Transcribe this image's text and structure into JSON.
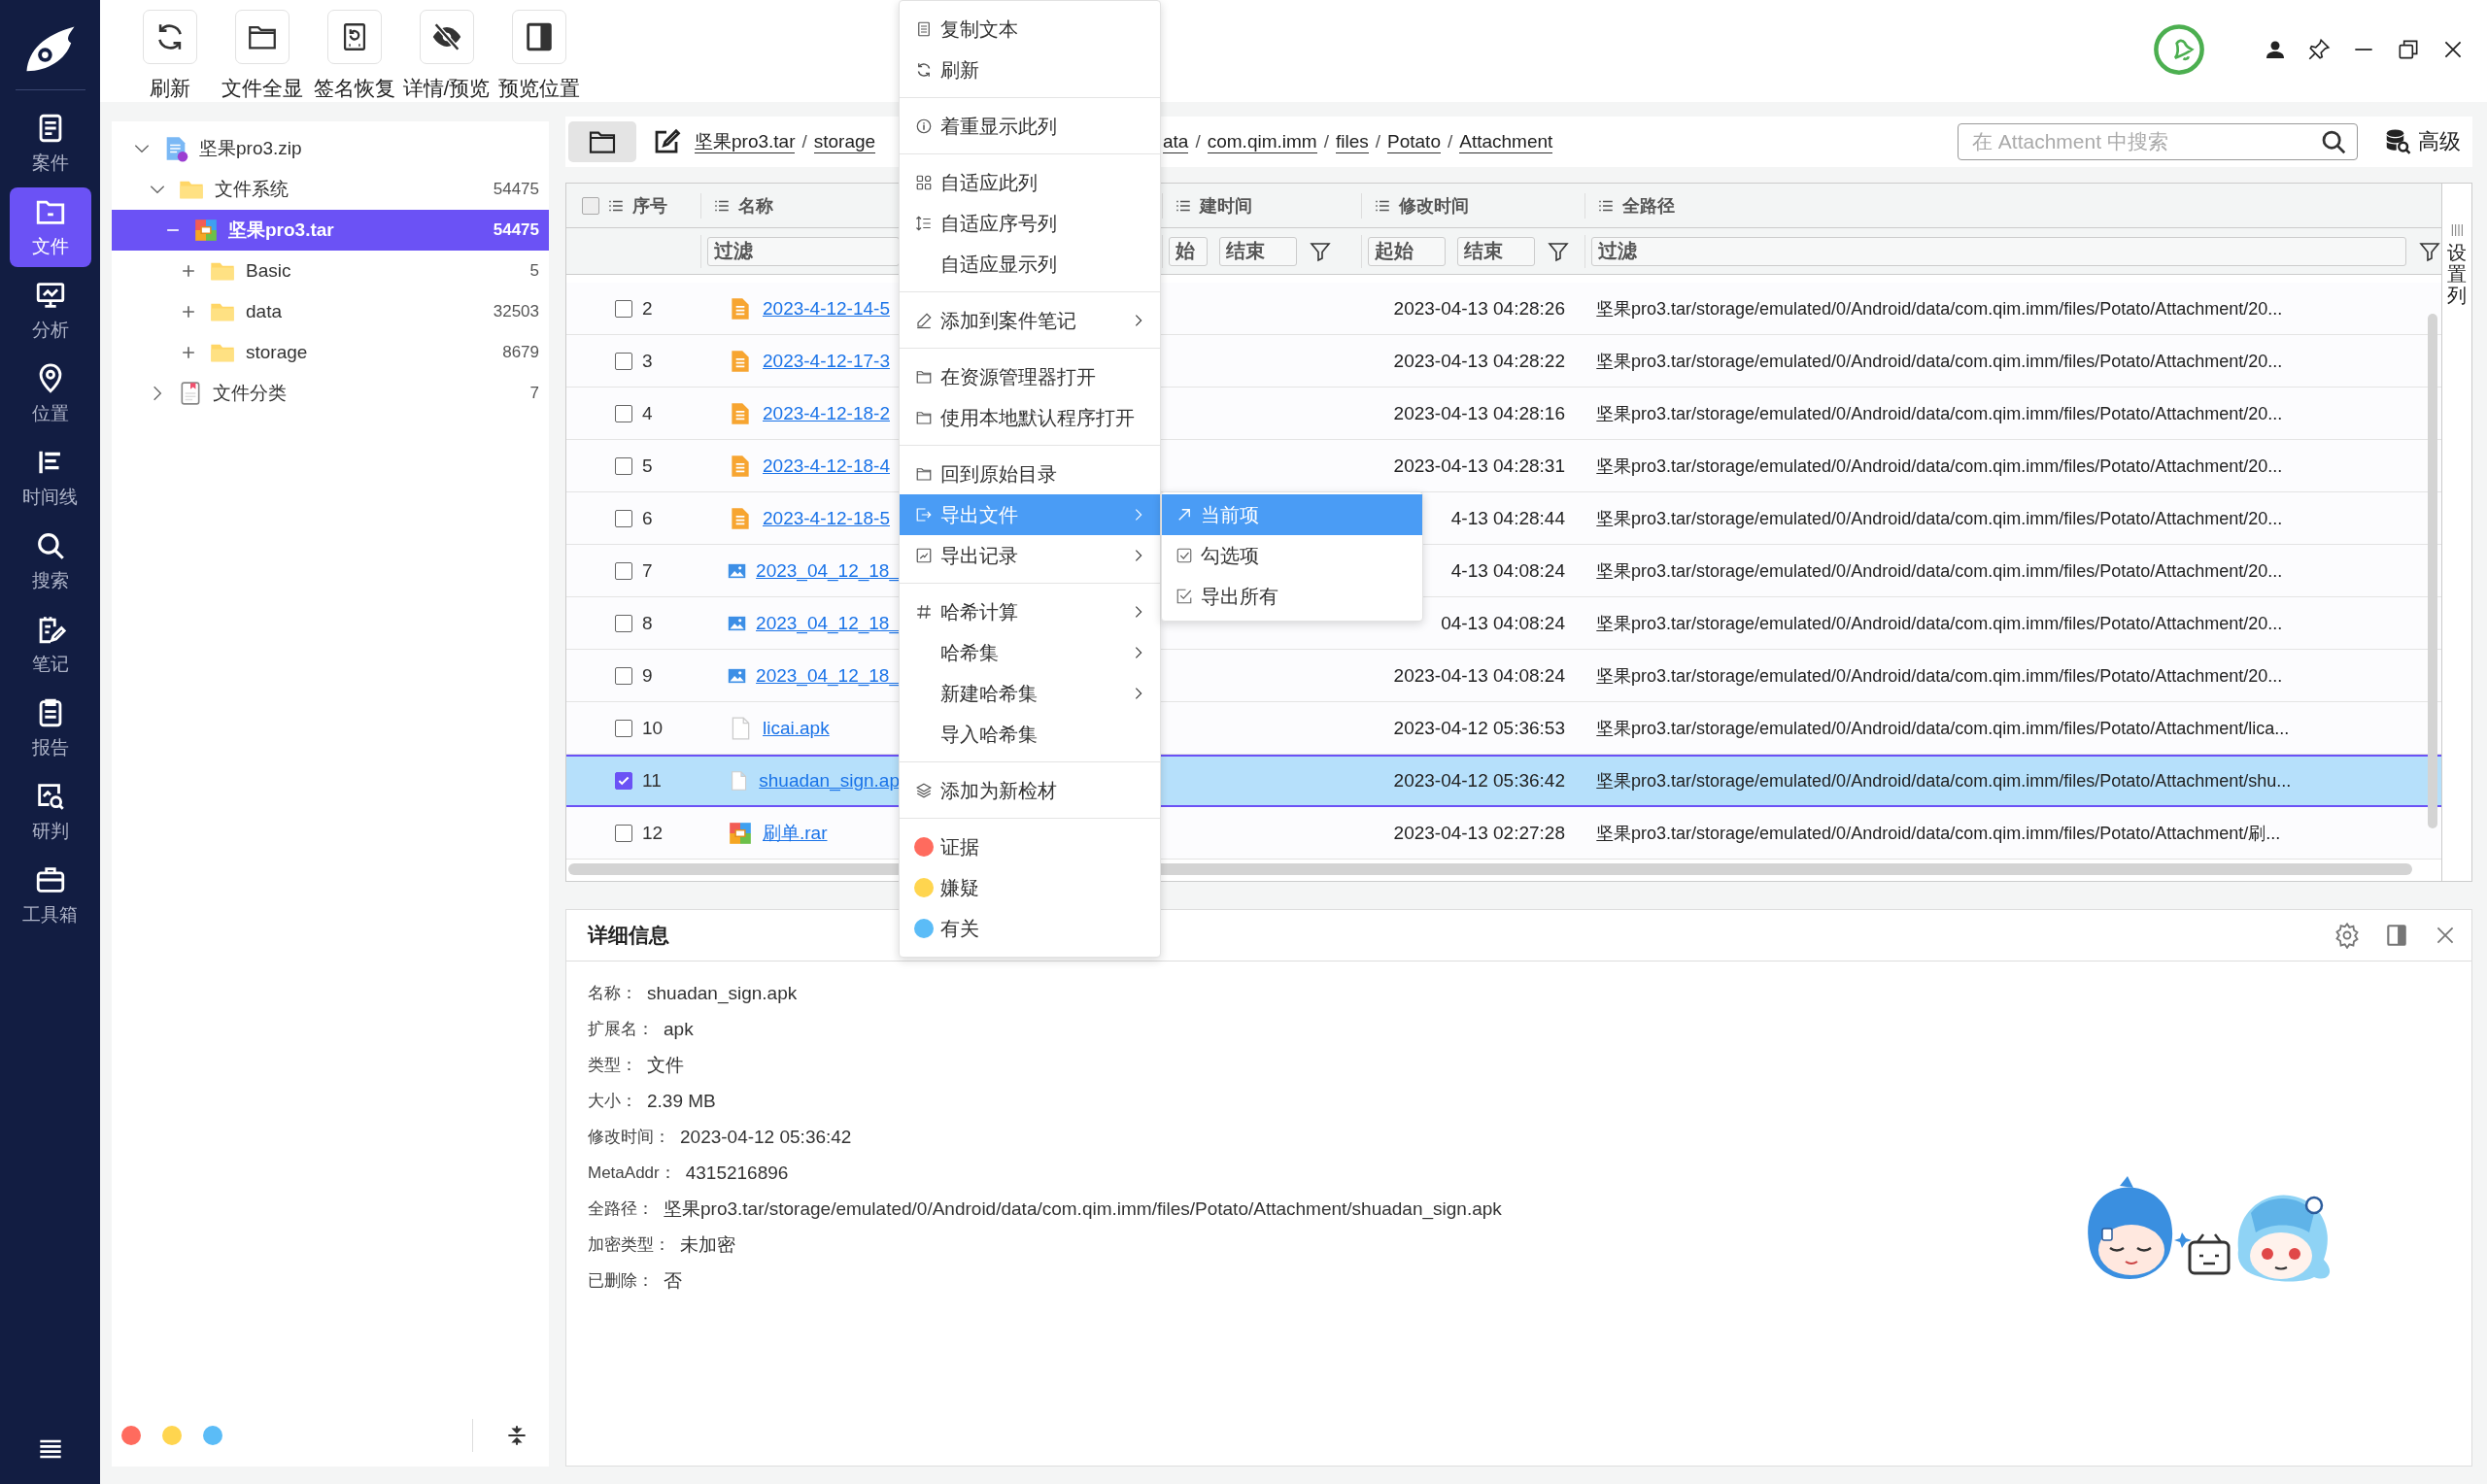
{
  "toolbar": [
    {
      "label": "刷新"
    },
    {
      "label": "文件全显"
    },
    {
      "label": "签名恢复"
    },
    {
      "label": "详情/预览"
    },
    {
      "label": "预览位置"
    }
  ],
  "sidebar": {
    "items": [
      {
        "label": "案件",
        "selected": false
      },
      {
        "label": "文件",
        "selected": true
      },
      {
        "label": "分析",
        "selected": false
      },
      {
        "label": "位置",
        "selected": false
      },
      {
        "label": "时间线",
        "selected": false
      },
      {
        "label": "搜索",
        "selected": false
      },
      {
        "label": "笔记",
        "selected": false
      },
      {
        "label": "报告",
        "selected": false
      },
      {
        "label": "研判",
        "selected": false
      },
      {
        "label": "工具箱",
        "selected": false
      }
    ]
  },
  "tree": [
    {
      "label": "坚果pro3.zip",
      "kind": "zip",
      "expanded": true,
      "selected": false,
      "children": [
        {
          "label": "文件系统",
          "count": "54475",
          "kind": "folder",
          "expanded": true,
          "selected": false,
          "children": [
            {
              "label": "坚果pro3.tar",
              "count": "54475",
              "kind": "archive",
              "expanded": true,
              "selected": true,
              "children": [
                {
                  "label": "Basic",
                  "count": "5",
                  "kind": "folder",
                  "expanded": false,
                  "selected": false
                },
                {
                  "label": "data",
                  "count": "32503",
                  "kind": "folder",
                  "expanded": false,
                  "selected": false
                },
                {
                  "label": "storage",
                  "count": "8679",
                  "kind": "folder",
                  "expanded": false,
                  "selected": false
                }
              ]
            }
          ]
        },
        {
          "label": "文件分类",
          "count": "7",
          "kind": "category",
          "expanded": false,
          "selected": false
        }
      ]
    }
  ],
  "tag_filters": [
    {
      "color": "#ff6b5e"
    },
    {
      "color": "#ffd54f"
    },
    {
      "color": "#5bbcf7"
    }
  ],
  "breadcrumb": {
    "start": [
      {
        "kind": "segment",
        "label": "坚果pro3.tar"
      },
      {
        "kind": "separator",
        "label": "/"
      },
      {
        "kind": "segment",
        "label": "storage"
      }
    ],
    "end": [
      {
        "kind": "segment",
        "label": "ata"
      },
      {
        "kind": "separator",
        "label": "/"
      },
      {
        "kind": "segment",
        "label": "com.qim.imm"
      },
      {
        "kind": "separator",
        "label": "/"
      },
      {
        "kind": "segment",
        "label": "files"
      },
      {
        "kind": "separator",
        "label": "/"
      },
      {
        "kind": "segment",
        "label": "Potato"
      },
      {
        "kind": "separator",
        "label": "/"
      },
      {
        "kind": "segment",
        "label": "Attachment"
      }
    ]
  },
  "search": {
    "placeholder": "在 Attachment 中搜索"
  },
  "advanced_button": {
    "label": "高级"
  },
  "table": {
    "all_checked": false,
    "columns": [
      {
        "label": "序号"
      },
      {
        "label": "名称",
        "filters": [
          {
            "placeholder": "过滤"
          }
        ]
      },
      {
        "label": "建时间",
        "filters": [
          {
            "placeholder": "始"
          },
          {
            "placeholder": "结束"
          }
        ]
      },
      {
        "label": "修改时间",
        "filters": [
          {
            "placeholder": "起始"
          },
          {
            "placeholder": "结束"
          }
        ]
      },
      {
        "label": "全路径",
        "filters": [
          {
            "placeholder": "过滤"
          }
        ]
      }
    ],
    "rows": [
      {
        "checked": false,
        "selected": false,
        "number": "2",
        "kind": "document",
        "name": "2023-4-12-14-5",
        "modified": "2023-04-13 04:28:26",
        "path": "坚果pro3.tar/storage/emulated/0/Android/data/com.qim.imm/files/Potato/Attachment/20..."
      },
      {
        "checked": false,
        "selected": false,
        "number": "3",
        "kind": "document",
        "name": "2023-4-12-17-3",
        "modified": "2023-04-13 04:28:22",
        "path": "坚果pro3.tar/storage/emulated/0/Android/data/com.qim.imm/files/Potato/Attachment/20..."
      },
      {
        "checked": false,
        "selected": false,
        "number": "4",
        "kind": "document",
        "name": "2023-4-12-18-2",
        "modified": "2023-04-13 04:28:16",
        "path": "坚果pro3.tar/storage/emulated/0/Android/data/com.qim.imm/files/Potato/Attachment/20..."
      },
      {
        "checked": false,
        "selected": false,
        "number": "5",
        "kind": "document",
        "name": "2023-4-12-18-4",
        "modified": "2023-04-13 04:28:31",
        "path": "坚果pro3.tar/storage/emulated/0/Android/data/com.qim.imm/files/Potato/Attachment/20..."
      },
      {
        "checked": false,
        "selected": false,
        "number": "6",
        "kind": "document",
        "name": "2023-4-12-18-5",
        "modified": "4-13 04:28:44",
        "path": "坚果pro3.tar/storage/emulated/0/Android/data/com.qim.imm/files/Potato/Attachment/20..."
      },
      {
        "checked": false,
        "selected": false,
        "number": "7",
        "kind": "image",
        "name": "2023_04_12_18_",
        "modified": "4-13 04:08:24",
        "path": "坚果pro3.tar/storage/emulated/0/Android/data/com.qim.imm/files/Potato/Attachment/20..."
      },
      {
        "checked": false,
        "selected": false,
        "number": "8",
        "kind": "image",
        "name": "2023_04_12_18_",
        "modified": "04-13 04:08:24",
        "path": "坚果pro3.tar/storage/emulated/0/Android/data/com.qim.imm/files/Potato/Attachment/20..."
      },
      {
        "checked": false,
        "selected": false,
        "number": "9",
        "kind": "image",
        "name": "2023_04_12_18_",
        "modified": "2023-04-13 04:08:24",
        "path": "坚果pro3.tar/storage/emulated/0/Android/data/com.qim.imm/files/Potato/Attachment/20..."
      },
      {
        "checked": false,
        "selected": false,
        "number": "10",
        "kind": "file",
        "name": "licai.apk",
        "modified": "2023-04-12 05:36:53",
        "path": "坚果pro3.tar/storage/emulated/0/Android/data/com.qim.imm/files/Potato/Attachment/lica..."
      },
      {
        "checked": true,
        "selected": true,
        "number": "11",
        "kind": "file",
        "name": "shuadan_sign.ap",
        "modified": "2023-04-12 05:36:42",
        "path": "坚果pro3.tar/storage/emulated/0/Android/data/com.qim.imm/files/Potato/Attachment/shu..."
      },
      {
        "checked": false,
        "selected": false,
        "number": "12",
        "kind": "archive",
        "name": "刷单.rar",
        "modified": "2023-04-13 02:27:28",
        "path": "坚果pro3.tar/storage/emulated/0/Android/data/com.qim.imm/files/Potato/Attachment/刷..."
      }
    ]
  },
  "column_settings": {
    "label": "设置列"
  },
  "context_menu": {
    "groups": [
      {
        "items": [
          {
            "label": "复制文本",
            "submenu": false,
            "selected": false
          },
          {
            "label": "刷新",
            "submenu": false,
            "selected": false
          }
        ]
      },
      {
        "items": [
          {
            "label": "着重显示此列",
            "submenu": false,
            "selected": false
          }
        ]
      },
      {
        "items": [
          {
            "label": "自适应此列",
            "submenu": false,
            "selected": false
          },
          {
            "label": "自适应序号列",
            "submenu": false,
            "selected": false
          },
          {
            "label": "自适应显示列",
            "submenu": false,
            "selected": false
          }
        ]
      },
      {
        "items": [
          {
            "label": "添加到案件笔记",
            "submenu": true,
            "selected": false
          }
        ]
      },
      {
        "items": [
          {
            "label": "在资源管理器打开",
            "submenu": false,
            "selected": false
          },
          {
            "label": "使用本地默认程序打开",
            "submenu": false,
            "selected": false
          }
        ]
      },
      {
        "items": [
          {
            "label": "回到原始目录",
            "submenu": false,
            "selected": false
          },
          {
            "label": "导出文件",
            "submenu": true,
            "selected": true
          },
          {
            "label": "导出记录",
            "submenu": true,
            "selected": false
          }
        ]
      },
      {
        "items": [
          {
            "label": "哈希计算",
            "submenu": true,
            "selected": false
          },
          {
            "label": "哈希集",
            "submenu": true,
            "selected": false
          },
          {
            "label": "新建哈希集",
            "submenu": true,
            "selected": false
          },
          {
            "label": "导入哈希集",
            "submenu": false,
            "selected": false
          }
        ]
      },
      {
        "items": [
          {
            "label": "添加为新检材",
            "submenu": false,
            "selected": false
          }
        ]
      },
      {
        "items": [
          {
            "label": "证据",
            "color": "#ff6b5e",
            "submenu": false,
            "selected": false
          },
          {
            "label": "嫌疑",
            "color": "#ffd54f",
            "submenu": false,
            "selected": false
          },
          {
            "label": "有关",
            "color": "#5bbcf7",
            "submenu": false,
            "selected": false
          }
        ]
      }
    ]
  },
  "submenu": {
    "items": [
      {
        "label": "当前项",
        "selected": true
      },
      {
        "label": "勾选项",
        "selected": false
      },
      {
        "label": "导出所有",
        "selected": false
      }
    ]
  },
  "details": {
    "title": "详细信息",
    "fields": [
      {
        "label": "名称：",
        "value": "shuadan_sign.apk"
      },
      {
        "label": "扩展名：",
        "value": "apk"
      },
      {
        "label": "类型：",
        "value": "文件"
      },
      {
        "label": "大小：",
        "value": "2.39 MB"
      },
      {
        "label": "修改时间：",
        "value": "2023-04-12 05:36:42"
      },
      {
        "label": "MetaAddr：",
        "value": "4315216896"
      },
      {
        "label": "全路径：",
        "value": "坚果pro3.tar/storage/emulated/0/Android/data/com.qim.imm/files/Potato/Attachment/shuadan_sign.apk"
      },
      {
        "label": "加密类型：",
        "value": "未加密"
      },
      {
        "label": "已删除：",
        "value": "否"
      }
    ]
  }
}
